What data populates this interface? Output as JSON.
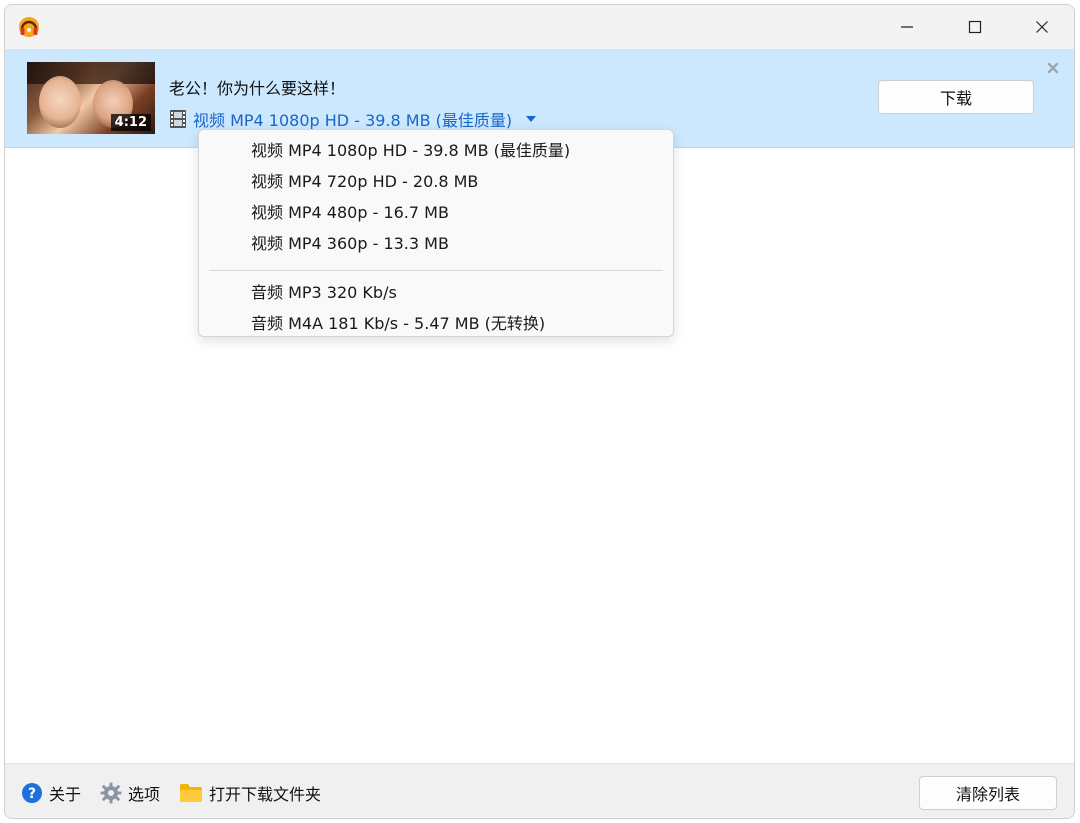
{
  "window": {
    "controls": [
      "minimize",
      "maximize",
      "close"
    ]
  },
  "item": {
    "title": "老公！你为什么要这样！",
    "duration": "4:12",
    "selected_format": "视频 MP4 1080p HD - 39.8 MB (最佳质量)",
    "download_label": "下载",
    "accent_color": "#1a66c7",
    "row_bg": "#cce8ff"
  },
  "format_menu": {
    "video": [
      "视频 MP4 1080p HD - 39.8 MB (最佳质量)",
      "视频 MP4 720p HD - 20.8 MB",
      "视频 MP4 480p - 16.7 MB",
      "视频 MP4 360p - 13.3 MB"
    ],
    "audio": [
      "音频 MP3 320 Kb/s",
      "音频 M4A 181 Kb/s - 5.47 MB (无转换)"
    ]
  },
  "footer": {
    "about": "关于",
    "options": "选项",
    "open_folder": "打开下载文件夹",
    "clear_list": "清除列表"
  }
}
